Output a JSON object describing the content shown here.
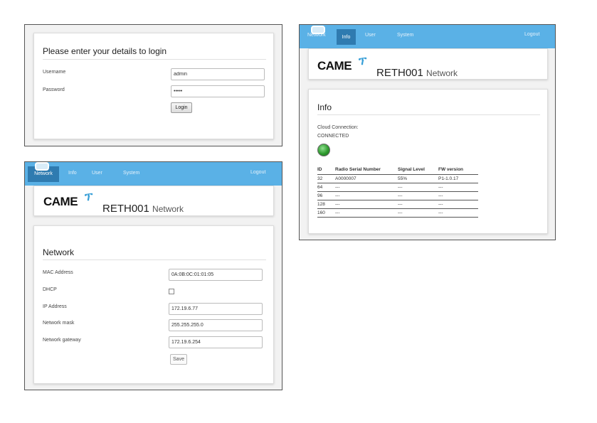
{
  "login": {
    "title": "Please enter your details to login",
    "username_label": "Username",
    "username_value": "admin",
    "password_label": "Password",
    "password_value": "•••••",
    "login_button": "Login"
  },
  "nav": {
    "items": [
      "Network",
      "Info",
      "User",
      "System"
    ],
    "logout": "Logout"
  },
  "brand": {
    "logo": "CAME",
    "product": "RETH001",
    "product_sub": "Network"
  },
  "network": {
    "title": "Network",
    "mac_label": "MAC Address",
    "mac_value": "0A:0B:0C:01:01:05",
    "dhcp_label": "DHCP",
    "dhcp_checked": false,
    "ip_label": "IP Address",
    "ip_value": "172.19.6.77",
    "mask_label": "Network mask",
    "mask_value": "255.255.255.0",
    "gateway_label": "Network gateway",
    "gateway_value": "172.19.6.254",
    "save_button": "Save"
  },
  "info": {
    "title": "Info",
    "cloud_label": "Cloud Connection:",
    "cloud_status": "CONNECTED",
    "status_color": "#2e9a2e",
    "table": {
      "headers": [
        "ID",
        "Radio Serial Number",
        "Signal Level",
        "FW version"
      ],
      "rows": [
        [
          "32",
          "A0000007",
          "55%",
          "P1-1.0.17"
        ],
        [
          "64",
          "---",
          "---",
          "---"
        ],
        [
          "96",
          "---",
          "---",
          "---"
        ],
        [
          "128",
          "---",
          "---",
          "---"
        ],
        [
          "160",
          "---",
          "---",
          "---"
        ]
      ]
    }
  },
  "colors": {
    "navbar": "#5ab1e6",
    "nav_active": "#2f7bb0",
    "logo_accent": "#3aa0d8"
  }
}
